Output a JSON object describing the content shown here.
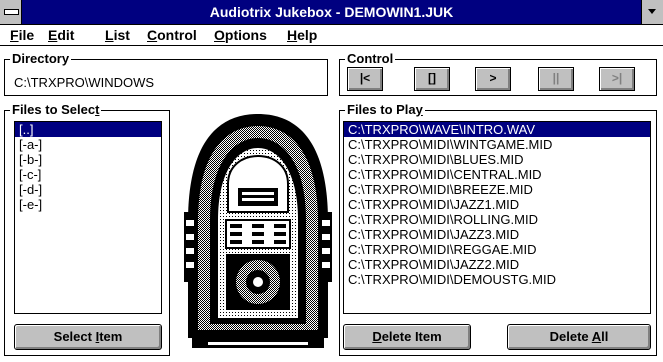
{
  "window": {
    "title": "Audiotrix Jukebox - DEMOWIN1.JUK"
  },
  "menu": {
    "file": {
      "pre": "",
      "key": "F",
      "post": "ile"
    },
    "edit": {
      "pre": "",
      "key": "E",
      "post": "dit"
    },
    "list": {
      "pre": "",
      "key": "L",
      "post": "ist"
    },
    "control": {
      "pre": "",
      "key": "C",
      "post": "ontrol"
    },
    "options": {
      "pre": "",
      "key": "O",
      "post": "ptions"
    },
    "help": {
      "pre": "",
      "key": "H",
      "post": "elp"
    }
  },
  "directory": {
    "label": "Directory",
    "path": "C:\\TRXPRO\\WINDOWS"
  },
  "control": {
    "label": "Control",
    "buttons": {
      "prev": "|<",
      "stop": "[]",
      "play": ">",
      "pause": "||",
      "next": ">|"
    }
  },
  "files_to_select": {
    "label_pre": "Files to Selec",
    "label_key": "t",
    "items": [
      "[..]",
      "[-a-]",
      "[-b-]",
      "[-c-]",
      "[-d-]",
      "[-e-]"
    ],
    "select_button": {
      "pre": "Select ",
      "key": "I",
      "post": "tem"
    }
  },
  "files_to_play": {
    "label_pre": "Files to Pla",
    "label_key": "y",
    "items": [
      "C:\\TRXPRO\\WAVE\\INTRO.WAV",
      "C:\\TRXPRO\\MIDI\\WINTGAME.MID",
      "C:\\TRXPRO\\MIDI\\BLUES.MID",
      "C:\\TRXPRO\\MIDI\\CENTRAL.MID",
      "C:\\TRXPRO\\MIDI\\BREEZE.MID",
      "C:\\TRXPRO\\MIDI\\JAZZ1.MID",
      "C:\\TRXPRO\\MIDI\\ROLLING.MID",
      "C:\\TRXPRO\\MIDI\\JAZZ3.MID",
      "C:\\TRXPRO\\MIDI\\REGGAE.MID",
      "C:\\TRXPRO\\MIDI\\JAZZ2.MID",
      "C:\\TRXPRO\\MIDI\\DEMOUSTG.MID"
    ],
    "delete_button": {
      "pre": "",
      "key": "D",
      "post": "elete Item"
    },
    "delete_all_button": {
      "pre": "Delete ",
      "key": "A",
      "post": "ll"
    }
  },
  "colors": {
    "titlebar": "#000080",
    "selection": "#000080",
    "button_face": "#c0c0c0"
  }
}
